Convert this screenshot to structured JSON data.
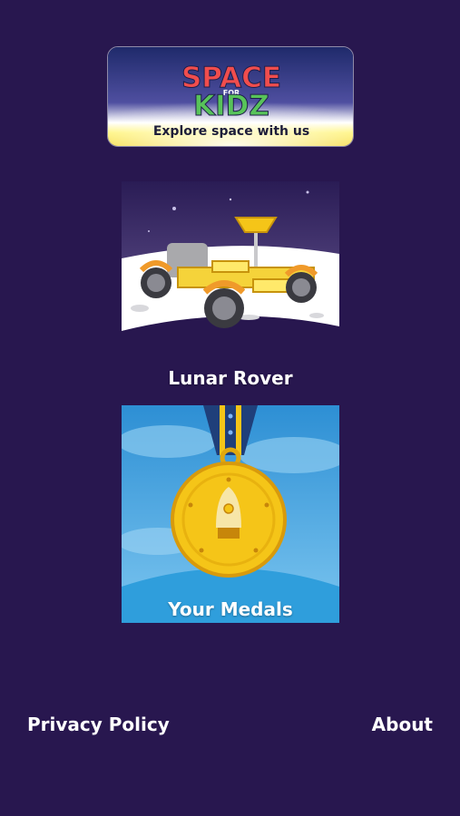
{
  "banner": {
    "logo_word_1": "SPACE",
    "logo_small": "FOR",
    "logo_word_2": "KIDZ",
    "tagline": "Explore space with us"
  },
  "menu": {
    "items": [
      {
        "label": "Lunar Rover",
        "icon": "lunar-rover-icon"
      },
      {
        "label": "Your Medals",
        "icon": "medal-icon"
      }
    ]
  },
  "footer": {
    "privacy_label": "Privacy Policy",
    "about_label": "About"
  },
  "colors": {
    "background": "#28174f",
    "medal_sky": "#3aa6e0",
    "medal_gold": "#f5c518"
  }
}
